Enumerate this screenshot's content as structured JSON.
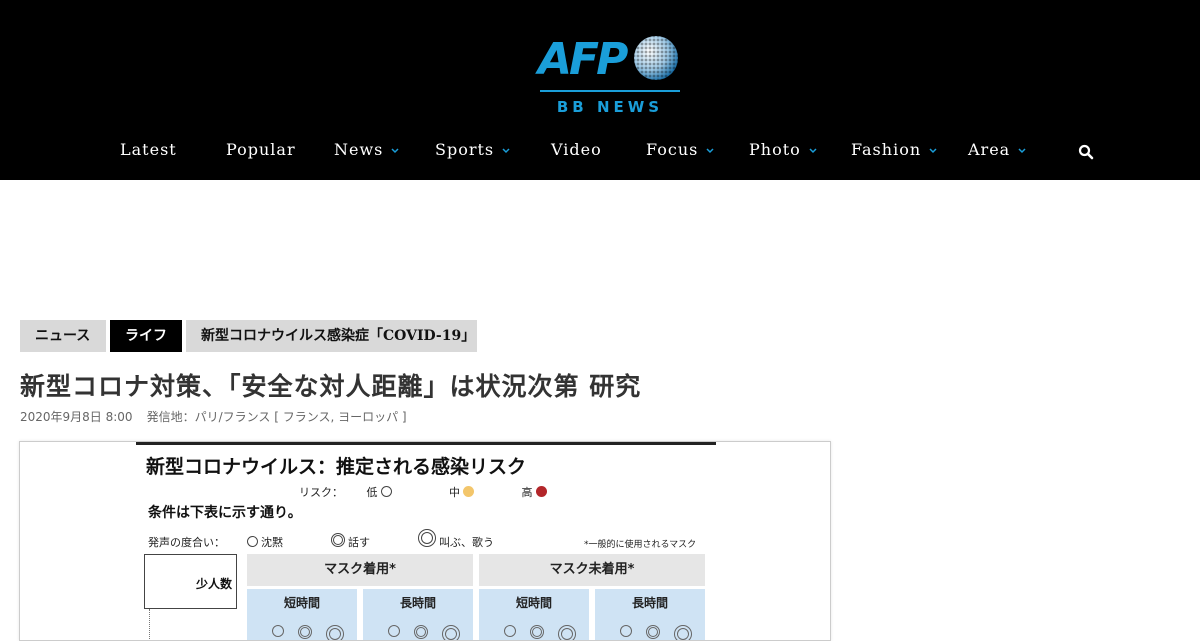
{
  "header": {
    "logo": {
      "brand": "AFP",
      "subtitle": "BB NEWS"
    },
    "nav": [
      {
        "label": "Latest",
        "has_menu": false
      },
      {
        "label": "Popular",
        "has_menu": false
      },
      {
        "label": "News",
        "has_menu": true
      },
      {
        "label": "Sports",
        "has_menu": true
      },
      {
        "label": "Video",
        "has_menu": false
      },
      {
        "label": "Focus",
        "has_menu": true
      },
      {
        "label": "Photo",
        "has_menu": true
      },
      {
        "label": "Fashion",
        "has_menu": true
      },
      {
        "label": "Area",
        "has_menu": true
      }
    ],
    "search_icon": "search-icon"
  },
  "breadcrumbs": [
    {
      "label": "ニュース"
    },
    {
      "label": "ライフ"
    },
    {
      "label": "新型コロナウイルス感染症「COVID-19」"
    }
  ],
  "article": {
    "title": "新型コロナ対策、「安全な対人距離」は状況次第 研究",
    "date": "2020年9月8日 8:00",
    "dateline": "発信地：パリ/フランス [ フランス, ヨーロッパ ]"
  },
  "figure": {
    "title": "新型コロナウイルス：推定される感染リスク",
    "risk_label": "リスク：",
    "risk_levels": [
      {
        "label": "低",
        "color": "#ffffff"
      },
      {
        "label": "中",
        "color": "#f3c66b"
      },
      {
        "label": "高",
        "color": "#b3262a"
      }
    ],
    "conditions": "条件は下表に示す通り。",
    "voice_label": "発声の度合い：",
    "voice_levels": [
      "沈黙",
      "話す",
      "叫ぶ、歌う"
    ],
    "mask_note": "*一般的に使用されるマスク",
    "row_label": "少人数",
    "columns": [
      {
        "label": "マスク着用*",
        "subs": [
          "短時間",
          "長時間"
        ]
      },
      {
        "label": "マスク未着用*",
        "subs": [
          "短時間",
          "長時間"
        ]
      }
    ]
  },
  "colors": {
    "brand": "#1a9ed9",
    "header_bg": "#000000",
    "chevron": "#1a9ed9"
  }
}
